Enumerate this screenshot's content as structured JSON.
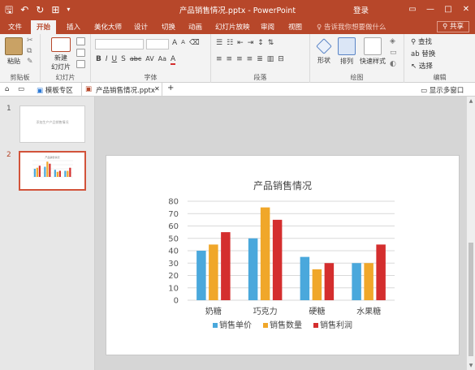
{
  "window": {
    "title": "产品销售情况.pptx - PowerPoint",
    "login": "登录",
    "minimize": "—",
    "restore": "□",
    "close": "✕"
  },
  "quick_access": {
    "undo_count_glyph": "↶",
    "redo_glyph": "↻"
  },
  "tabs": [
    {
      "label": "文件",
      "active": false
    },
    {
      "label": "开始",
      "active": true
    },
    {
      "label": "插入",
      "active": false
    },
    {
      "label": "美化大师",
      "active": false
    },
    {
      "label": "设计",
      "active": false
    },
    {
      "label": "切换",
      "active": false
    },
    {
      "label": "动画",
      "active": false
    },
    {
      "label": "幻灯片放映",
      "active": false
    },
    {
      "label": "审阅",
      "active": false
    },
    {
      "label": "视图",
      "active": false
    }
  ],
  "tell_me": "告诉我你想要做什么",
  "share": "共享",
  "ribbon": {
    "clipboard": {
      "paste": "粘贴",
      "label": "剪贴板"
    },
    "slides": {
      "new_slide_line1": "新建",
      "new_slide_line2": "幻灯片",
      "label": "幻灯片"
    },
    "font": {
      "label": "字体",
      "bold": "B",
      "italic": "I",
      "underline": "U",
      "strike": "S",
      "abc": "abc",
      "spacing": "AV",
      "case": "Aa",
      "font_color": "A"
    },
    "paragraph": {
      "label": "段落"
    },
    "drawing": {
      "shape": "形状",
      "arrange": "排列",
      "quick_styles": "快速样式",
      "label": "绘图"
    },
    "editing": {
      "find": "查找",
      "replace": "替换",
      "select": "选择",
      "label": "编辑"
    }
  },
  "docbar": {
    "templates": "模板专区",
    "file_tab": "产品销售情况.pptx",
    "show_windows": "显示多窗口"
  },
  "thumbnails": [
    {
      "number": "1",
      "text": "添加生产产品销售情况"
    },
    {
      "number": "2",
      "text": ""
    }
  ],
  "colors": {
    "accent": "#b7472a",
    "series_price": "#4aa8dc",
    "series_qty": "#f0a72a",
    "series_profit": "#d42e2e"
  },
  "chart_data": {
    "type": "bar",
    "title": "产品销售情况",
    "categories": [
      "奶糖",
      "巧克力",
      "硬糖",
      "水果糖"
    ],
    "series": [
      {
        "name": "销售单价",
        "values": [
          40,
          50,
          35,
          30
        ]
      },
      {
        "name": "销售数量",
        "values": [
          45,
          75,
          25,
          30
        ]
      },
      {
        "name": "销售利润",
        "values": [
          55,
          65,
          30,
          45
        ]
      }
    ],
    "ylim": [
      0,
      80
    ],
    "yticks": [
      0,
      10,
      20,
      30,
      40,
      50,
      60,
      70,
      80
    ],
    "legend": "bottom",
    "grid": true
  }
}
